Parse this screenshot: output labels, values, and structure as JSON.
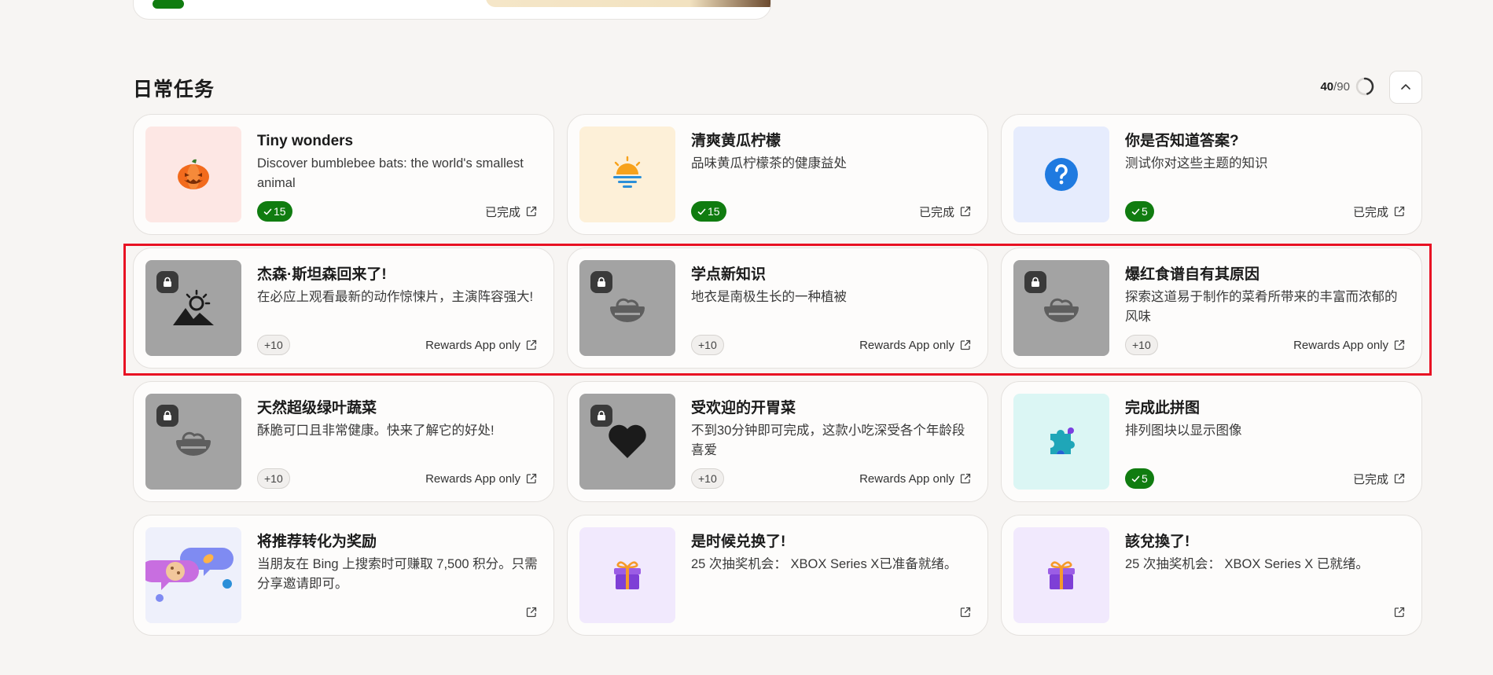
{
  "section": {
    "title": "日常任务",
    "progress_current": "40",
    "progress_total": "/90",
    "progress_fraction": 0.444
  },
  "cards": [
    {
      "title": "Tiny wonders",
      "desc": "Discover bumblebee bats: the world's smallest animal",
      "points": "15",
      "status": "已完成",
      "icon": "pumpkin-icon",
      "thumb_bg": "#fde7e4"
    },
    {
      "title": "清爽黄瓜柠檬",
      "desc": "品味黄瓜柠檬茶的健康益处",
      "points": "15",
      "status": "已完成",
      "icon": "sunset-icon",
      "thumb_bg": "#fdf0d8"
    },
    {
      "title": "你是否知道答案?",
      "desc": "测试你对这些主题的知识",
      "points": "5",
      "status": "已完成",
      "icon": "question-icon",
      "thumb_bg": "#e6ecfd"
    },
    {
      "title": "杰森·斯坦森回来了!",
      "desc": "在必应上观看最新的动作惊悚片，主演阵容强大!",
      "points": "+10",
      "status": "Rewards App only",
      "icon": "mountain-sun-icon",
      "thumb_bg": "#a3a3a3"
    },
    {
      "title": "学点新知识",
      "desc": "地衣是南极生长的一种植被",
      "points": "+10",
      "status": "Rewards App only",
      "icon": "salad-bowl-icon",
      "thumb_bg": "#a3a3a3"
    },
    {
      "title": "爆红食谱自有其原因",
      "desc": "探索这道易于制作的菜肴所带来的丰富而浓郁的风味",
      "points": "+10",
      "status": "Rewards App only",
      "icon": "salad-bowl-icon",
      "thumb_bg": "#a3a3a3"
    },
    {
      "title": "天然超级绿叶蔬菜",
      "desc": "酥脆可口且非常健康。快来了解它的好处!",
      "points": "+10",
      "status": "Rewards App only",
      "icon": "salad-bowl-icon",
      "thumb_bg": "#a3a3a3"
    },
    {
      "title": "受欢迎的开胃菜",
      "desc": "不到30分钟即可完成，这款小吃深受各个年龄段喜爱",
      "points": "+10",
      "status": "Rewards App only",
      "icon": "heart-icon",
      "thumb_bg": "#a3a3a3"
    },
    {
      "title": "完成此拼图",
      "desc": "排列图块以显示图像",
      "points": "5",
      "status": "已完成",
      "icon": "puzzle-icon",
      "thumb_bg": "#dbf6f4"
    },
    {
      "title": "将推荐转化为奖励",
      "desc": "当朋友在 Bing 上搜索时可赚取 7,500 积分。只需分享邀请即可。",
      "points": "",
      "status": "",
      "icon": "chat-bubbles-icon",
      "thumb_bg": "#eef0fb"
    },
    {
      "title": "是时候兑换了!",
      "desc": "25 次抽奖机会： XBOX Series X已准备就绪。",
      "points": "",
      "status": "",
      "icon": "gift-icon",
      "thumb_bg": "#f1e9fd"
    },
    {
      "title": "該兌換了!",
      "desc": "25 次抽奖机会： XBOX Series X 已就绪。",
      "points": "",
      "status": "",
      "icon": "gift-icon",
      "thumb_bg": "#f1e9fd"
    }
  ],
  "colors": {
    "done_green": "#107c10",
    "highlight_red": "#e81123",
    "locked_gray": "#a3a3a3"
  }
}
